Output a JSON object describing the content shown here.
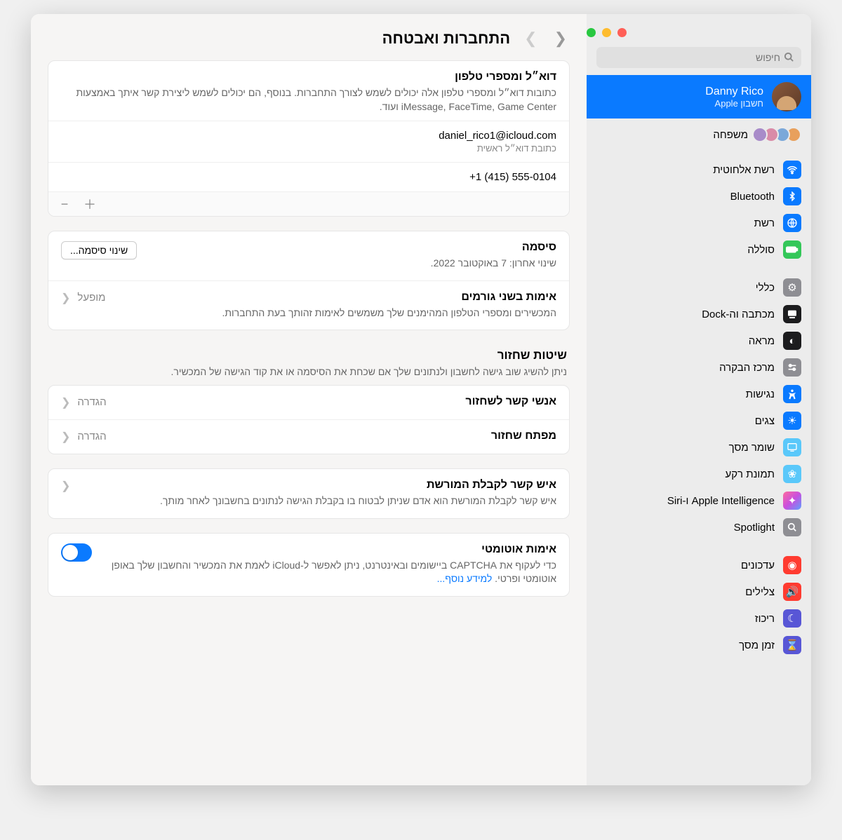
{
  "search": {
    "placeholder": "חיפוש"
  },
  "user": {
    "name": "Danny Rico",
    "sub": "חשבון Apple"
  },
  "family": {
    "label": "משפחה"
  },
  "nav": {
    "wifi": "רשת אלחוטית",
    "bluetooth": "Bluetooth",
    "network": "רשת",
    "battery": "סוללה",
    "general": "כללי",
    "dock": "מכתבה וה-Dock",
    "appearance": "מראה",
    "control": "מרכז הבקרה",
    "accessibility": "נגישות",
    "displays": "צגים",
    "screensaver": "שומר מסך",
    "wallpaper": "תמונת רקע",
    "siri": "Apple Intelligence ו-Siri",
    "spotlight": "Spotlight",
    "updates": "עדכונים",
    "sounds": "צלילים",
    "focus": "ריכוז",
    "screentime": "זמן מסך"
  },
  "main": {
    "title": "התחברות ואבטחה",
    "contacts": {
      "title": "דוא״ל ומספרי טלפון",
      "desc": "כתובות דוא״ל ומספרי טלפון אלה יכולים לשמש לצורך התחברות. בנוסף, הם יכולים לשמש ליצירת קשר איתך באמצעות iMessage, FaceTime, Game Center ועוד.",
      "email": "daniel_rico1@icloud.com",
      "email_sub": "כתובת דוא״ל ראשית",
      "phone": "+1 (415) 555-0104"
    },
    "password": {
      "title": "סיסמה",
      "sub": "שינוי אחרון: 7 באוקטובר 2022.",
      "button": "שינוי סיסמה..."
    },
    "twofa": {
      "title": "אימות בשני גורמים",
      "desc": "המכשירים ומספרי הטלפון המהימנים שלך משמשים לאימות זהותך בעת התחברות.",
      "status": "מופעל"
    },
    "recovery": {
      "section_title": "שיטות שחזור",
      "section_desc": "ניתן להשיג שוב גישה לחשבון ולנתונים שלך אם שכחת את הסיסמה או את קוד הגישה של המכשיר.",
      "contact_title": "אנשי קשר לשחזור",
      "key_title": "מפתח שחזור",
      "setup": "הגדרה"
    },
    "legacy": {
      "title": "איש קשר לקבלת המורשת",
      "desc": "איש קשר לקבלת המורשת הוא אדם שניתן לבטוח בו בקבלת הגישה לנתונים בחשבונך לאחר מותך."
    },
    "autoverify": {
      "title": "אימות אוטומטי",
      "desc": "כדי לעקוף את CAPTCHA ביישומים ובאינטרנט, ניתן לאפשר ל-iCloud לאמת את המכשיר והחשבון שלך באופן אוטומטי ופרטי. ",
      "link": "למידע נוסף..."
    }
  }
}
